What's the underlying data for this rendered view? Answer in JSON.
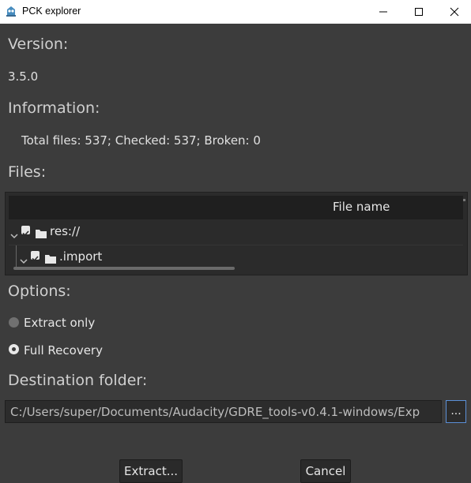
{
  "window": {
    "title": "PCK explorer",
    "icon": "godot-icon",
    "controls": [
      "minimize-icon",
      "maximize-icon",
      "close-icon"
    ]
  },
  "version": {
    "heading": "Version:",
    "value": "3.5.0"
  },
  "information": {
    "heading": "Information:",
    "text": "Total files: 537; Checked: 537; Broken: 0"
  },
  "files": {
    "heading": "Files:",
    "column_header": "File name",
    "rows": [
      {
        "label": "res://",
        "checked": true,
        "expanded": true,
        "icon": "folder-icon"
      },
      {
        "label": ".import",
        "checked": true,
        "expanded": true,
        "icon": "folder-icon"
      }
    ]
  },
  "options": {
    "heading": "Options:",
    "choices": [
      {
        "label": "Extract only",
        "selected": false
      },
      {
        "label": "Full Recovery",
        "selected": true
      }
    ]
  },
  "destination": {
    "heading": "Destination folder:",
    "value": "C:/Users/super/Documents/Audacity/GDRE_tools-v0.4.1-windows/Exp",
    "browse_label": "..."
  },
  "buttons": {
    "extract": "Extract...",
    "cancel": "Cancel"
  },
  "colors": {
    "background": "#3c3c3c",
    "panel": "#2b2b2b",
    "accent": "#5b8fd6"
  }
}
